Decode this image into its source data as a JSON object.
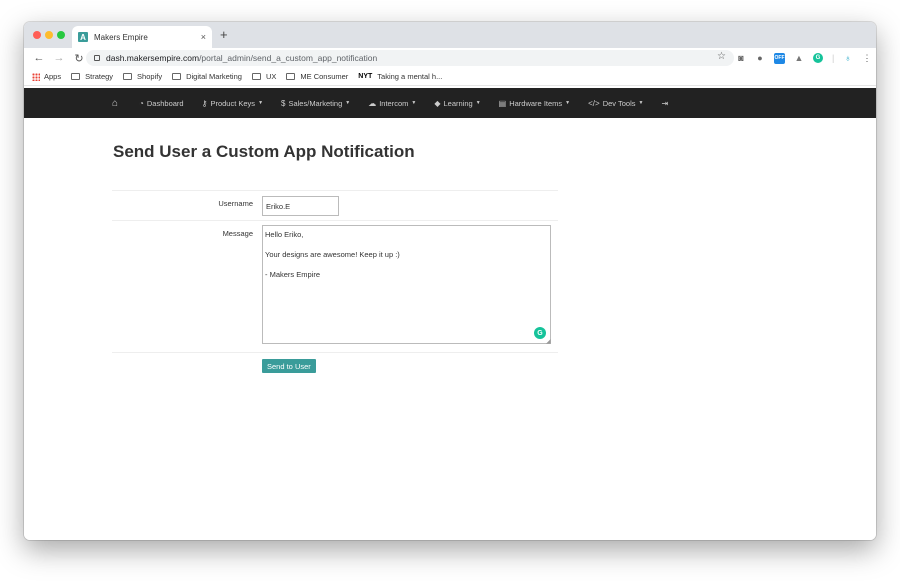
{
  "browser": {
    "tab_title": "Makers Empire",
    "tab_favicon": "A",
    "tab_close": "×",
    "new_tab": "+",
    "url_host": "dash.makersempire.com",
    "url_path": "/portal_admin/send_a_custom_app_notification",
    "off_badge": "OFF",
    "grammarly_letter": "G",
    "bookmarks": [
      {
        "label": "Apps",
        "icon": "apps-grid-icon"
      },
      {
        "label": "Strategy",
        "icon": "folder-icon"
      },
      {
        "label": "Shopify",
        "icon": "folder-icon"
      },
      {
        "label": "Digital Marketing",
        "icon": "folder-icon"
      },
      {
        "label": "UX",
        "icon": "folder-icon"
      },
      {
        "label": "ME Consumer",
        "icon": "folder-icon"
      },
      {
        "label": "Taking a mental h...",
        "icon": "nyt-icon"
      }
    ],
    "nyt_logo": "NYT"
  },
  "navbar": {
    "items": [
      {
        "label": "",
        "icon": "home-icon"
      },
      {
        "label": "Dashboard",
        "icon": "dashboard-icon"
      },
      {
        "label": "Product Keys",
        "icon": "key-icon"
      },
      {
        "label": "Sales/Marketing",
        "icon": "dollar-icon"
      },
      {
        "label": "Intercom",
        "icon": "cloud-icon"
      },
      {
        "label": "Learning",
        "icon": "graduation-cap-icon"
      },
      {
        "label": "Hardware Items",
        "icon": "server-icon"
      },
      {
        "label": "Dev Tools",
        "icon": "code-icon"
      },
      {
        "label": "",
        "icon": "sign-out-icon"
      }
    ]
  },
  "main": {
    "title": "Send User a Custom App Notification",
    "username_label": "Username",
    "username_value": "Eriko.E",
    "message_label": "Message",
    "message_value": "Hello Eriko,\n\nYour designs are awesome! Keep it up :)\n\n- Makers Empire",
    "submit_label": "Send to User"
  },
  "colors": {
    "accent": "#3a9c9a",
    "navbar_bg": "#222222"
  }
}
